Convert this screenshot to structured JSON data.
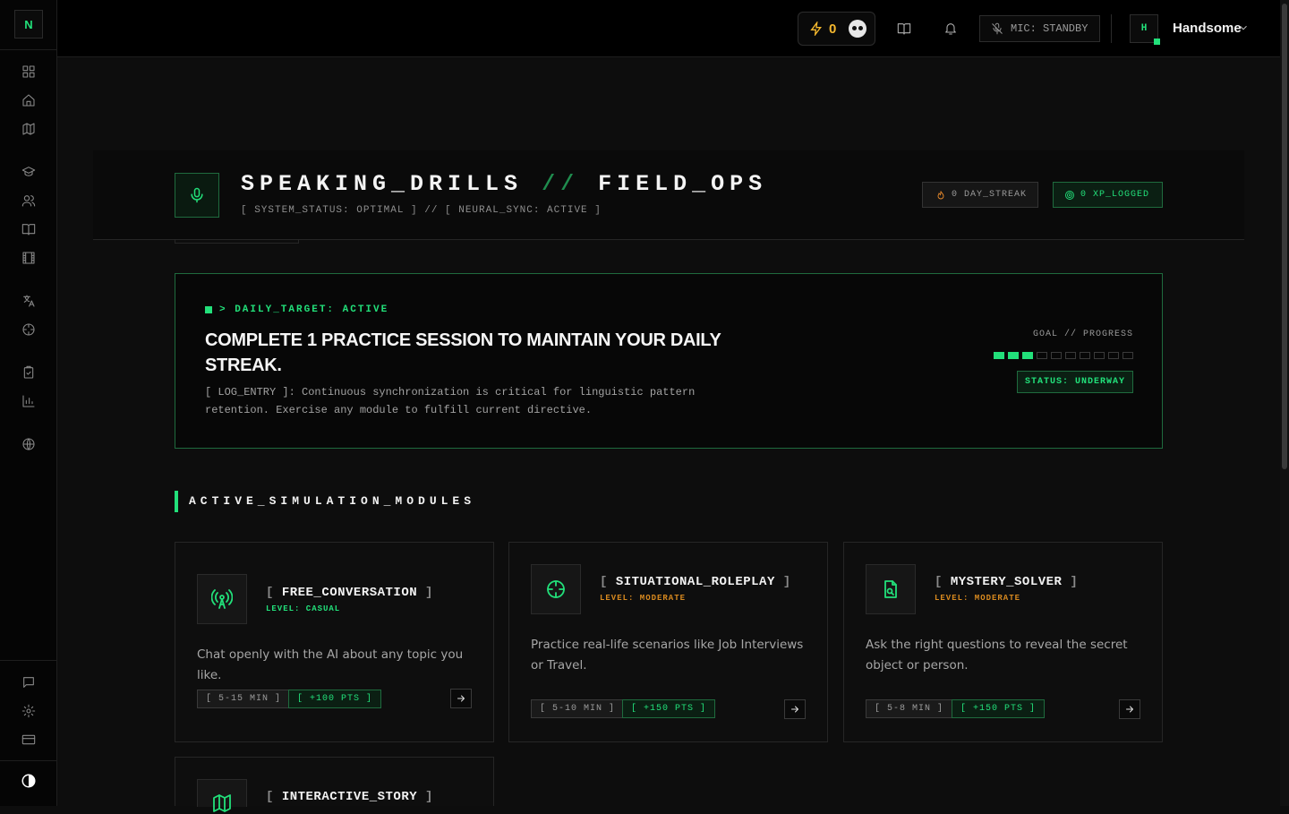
{
  "app": {
    "logo": "N"
  },
  "sidebar": {
    "items": [
      {
        "icon": "dashboard-icon"
      },
      {
        "icon": "home-icon"
      },
      {
        "icon": "map-icon"
      },
      {
        "icon": "graduation-cap-icon"
      },
      {
        "icon": "users-icon"
      },
      {
        "icon": "book-icon"
      },
      {
        "icon": "film-icon"
      },
      {
        "icon": "translate-icon"
      },
      {
        "icon": "target-icon"
      },
      {
        "icon": "clipboard-icon"
      },
      {
        "icon": "bar-chart-icon"
      },
      {
        "icon": "globe-icon"
      },
      {
        "icon": "chat-icon"
      },
      {
        "icon": "settings-icon"
      },
      {
        "icon": "credit-card-icon"
      },
      {
        "icon": "theme-toggle-icon"
      }
    ]
  },
  "topbar": {
    "xp_value": "0",
    "mic_label": "MIC: STANDBY",
    "user_initial": "H",
    "username": "Handsome"
  },
  "header": {
    "title_left": "SPEAKING_DRILLS",
    "title_sep": "//",
    "title_right": "FIELD_OPS",
    "subtitle": "[ SYSTEM_STATUS: OPTIMAL ] // [ NEURAL_SYNC: ACTIVE ]",
    "streak": "0 DAY_STREAK",
    "xp_logged": "0 XP_LOGGED"
  },
  "daily_target": {
    "tag": "> DAILY_TARGET: ACTIVE",
    "title": "COMPLETE 1 PRACTICE SESSION TO MAINTAIN YOUR DAILY STREAK.",
    "log": "[ LOG_ENTRY ]: Continuous synchronization is critical for linguistic pattern retention. Exercise any module to fulfill current directive.",
    "goal_label": "GOAL // PROGRESS",
    "progress_filled": 3,
    "progress_total": 10,
    "status": "STATUS: UNDERWAY"
  },
  "section": {
    "title": "ACTIVE_SIMULATION_MODULES"
  },
  "modules": [
    {
      "name": "FREE_CONVERSATION",
      "level": "LEVEL: CASUAL",
      "level_color": "#22e07a",
      "desc": "Chat openly with the AI about any topic you like.",
      "time": "[ 5-15 MIN ]",
      "pts": "[ +100 PTS ]",
      "icon": "radio-tower-icon"
    },
    {
      "name": "SITUATIONAL_ROLEPLAY",
      "level": "LEVEL: MODERATE",
      "level_color": "#d98a1f",
      "desc": "Practice real-life scenarios like Job Interviews or Travel.",
      "time": "[ 5-10 MIN ]",
      "pts": "[ +150 PTS ]",
      "icon": "crosshair-icon"
    },
    {
      "name": "MYSTERY_SOLVER",
      "level": "LEVEL: MODERATE",
      "level_color": "#d98a1f",
      "desc": "Ask the right questions to reveal the secret object or person.",
      "time": "[ 5-8 MIN ]",
      "pts": "[ +150 PTS ]",
      "icon": "file-search-icon"
    },
    {
      "name": "INTERACTIVE_STORY",
      "icon": "map-icon"
    }
  ],
  "colors": {
    "accent": "#22e07a",
    "warning": "#d98a1f",
    "streak": "#e98a2b",
    "xp": "#f5b82e"
  }
}
